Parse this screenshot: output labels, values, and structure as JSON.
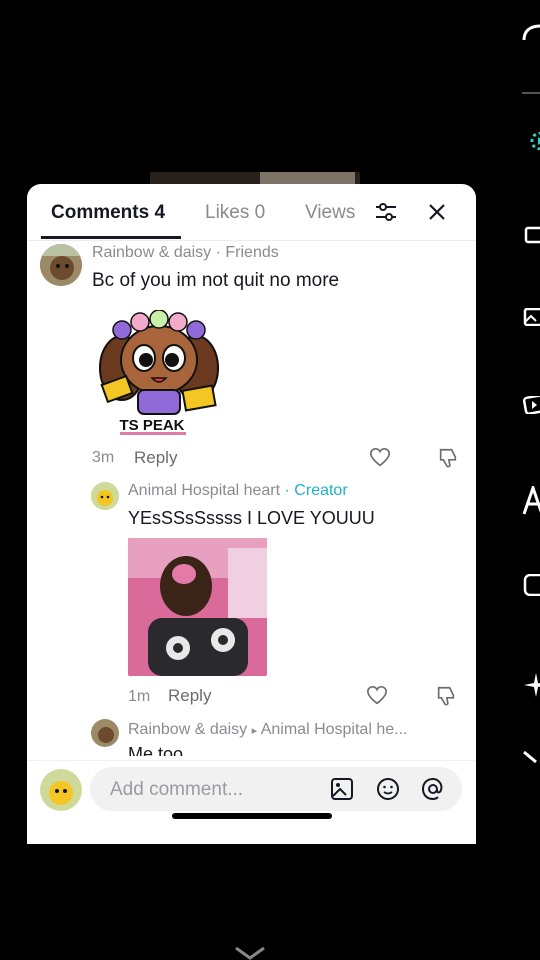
{
  "tabs": [
    {
      "label": "Comments 4",
      "active": true
    },
    {
      "label": "Likes 0",
      "active": false
    },
    {
      "label": "Views",
      "active": false
    }
  ],
  "comments": [
    {
      "author": "Rainbow & daisy",
      "tag": "· Friends",
      "text": "Bc of you im not quit no more",
      "sticker_text": "TS PEAK",
      "time": "3m",
      "reply_label": "Reply"
    },
    {
      "author": "Animal Hospital heart",
      "tag": "· Creator",
      "text": "YEsSSsSssss I LOVE YOUUU",
      "time": "1m",
      "reply_label": "Reply"
    },
    {
      "author": "Rainbow & daisy",
      "reply_to": "Animal Hospital he...",
      "text": "Me too"
    }
  ],
  "input": {
    "placeholder": "Add comment..."
  },
  "icons": {
    "filter": "sliders-icon",
    "close": "close-icon",
    "like": "heart-icon",
    "dislike": "thumbs-down-icon",
    "image": "image-icon",
    "emoji": "emoji-icon",
    "mention": "at-icon"
  },
  "colors": {
    "creator": "#20b3c6",
    "accent_tabs": "#161823"
  }
}
